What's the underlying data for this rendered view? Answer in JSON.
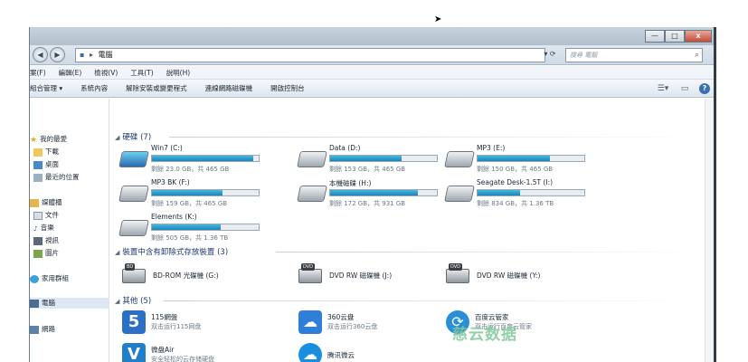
{
  "window": {
    "minimize": "—",
    "maximize": "□",
    "close": "x"
  },
  "nav": {
    "back": "◀",
    "forward": "▶"
  },
  "address": {
    "root_glyph": "▸",
    "crumb": "電腦"
  },
  "search": {
    "placeholder": "搜尋 電腦"
  },
  "menu": [
    "案(F)",
    "編輯(E)",
    "檢視(V)",
    "工具(T)",
    "說明(H)"
  ],
  "toolbar": [
    "組合管理 ▾",
    "系統內容",
    "解除安裝或變更程式",
    "連線網路磁碟機",
    "開啟控制台"
  ],
  "sidebar": {
    "favorites": "我的最愛",
    "downloads": "下載",
    "desktop": "桌面",
    "recent": "最近的位置",
    "libraries": "媒體櫃",
    "documents": "文件",
    "music": "音樂",
    "videos": "視訊",
    "pictures": "圖片",
    "homegroup": "家用群組",
    "computer": "電腦",
    "network": "網路"
  },
  "groups": {
    "hard_drives": "硬碟 (7)",
    "removable": "裝置中含有卸除式存放裝置 (3)",
    "other": "其他 (5)"
  },
  "drives": [
    {
      "name": "Win7 (C:)",
      "free": "剩餘 23.0 GB，共 465 GB",
      "used_fraction": 0.95,
      "icon": "windows-drive-icon"
    },
    {
      "name": "Data (D:)",
      "free": "剩餘 153 GB，共 465 GB",
      "used_fraction": 0.67,
      "icon": "hard-drive-icon"
    },
    {
      "name": "MP3 (E:)",
      "free": "剩餘 150 GB，共 465 GB",
      "used_fraction": 0.68,
      "icon": "hard-drive-icon"
    },
    {
      "name": "MP3 BK (F:)",
      "free": "剩餘 159 GB，共 465 GB",
      "used_fraction": 0.66,
      "icon": "hard-drive-icon"
    },
    {
      "name": "本機磁碟 (H:)",
      "free": "剩餘 172 GB，共 931 GB",
      "used_fraction": 0.82,
      "icon": "hard-drive-icon"
    },
    {
      "name": "Seagate Desk-1.5T (I:)",
      "free": "剩餘 834 GB，共 1.36 TB",
      "used_fraction": 0.4,
      "icon": "hard-drive-icon"
    },
    {
      "name": "Elements (K:)",
      "free": "剩餘 505 GB，共 1.36 TB",
      "used_fraction": 0.64,
      "icon": "hard-drive-icon"
    }
  ],
  "removable": [
    {
      "name": "BD-ROM 光碟機 (G:)",
      "badge": "BD"
    },
    {
      "name": "DVD RW 磁碟機 (J:)",
      "badge": "DVD"
    },
    {
      "name": "DVD RW 磁碟機 (Y:)",
      "badge": "DVD"
    }
  ],
  "others": [
    {
      "name": "115網盤",
      "desc": "双击运行115网盘",
      "glyph": "5",
      "color": "#2b6fc6"
    },
    {
      "name": "360云盘",
      "desc": "双击运行360云盘",
      "glyph": "☁",
      "color": "#2f7ed8"
    },
    {
      "name": "百度云管家",
      "desc": "双击运行百度云管家",
      "glyph": "⟳",
      "color": "#2a8fd6"
    },
    {
      "name": "微盘Air",
      "desc": "安全轻松的云存储硬盘",
      "glyph": "V",
      "color": "#1f7fc9"
    },
    {
      "name": "腾讯微云",
      "desc": "",
      "glyph": "☁",
      "color": "#1a8ee0"
    }
  ],
  "watermark": "慈云数据"
}
